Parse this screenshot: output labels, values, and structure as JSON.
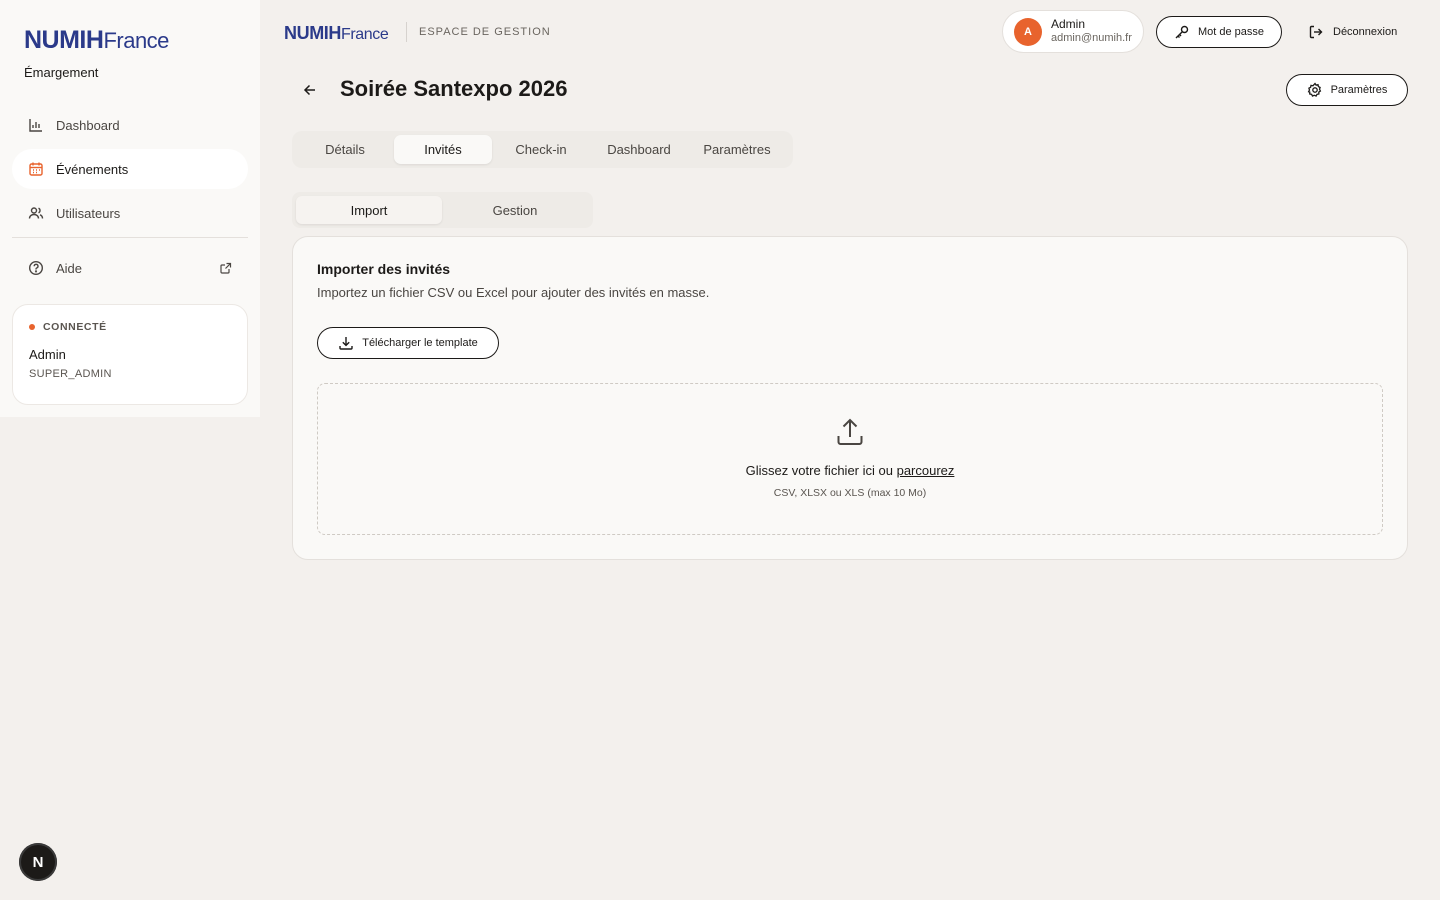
{
  "sidebar": {
    "logo_brand": "NUMIH",
    "logo_suffix": "France",
    "app_name": "Émargement",
    "items": [
      {
        "label": "Dashboard",
        "icon": "bar-chart-icon"
      },
      {
        "label": "Événements",
        "icon": "calendar-icon"
      },
      {
        "label": "Utilisateurs",
        "icon": "users-icon"
      }
    ],
    "help": {
      "label": "Aide",
      "icon": "help-circle-icon",
      "ext_icon": "external-link-icon"
    },
    "user_card": {
      "status": "CONNECTÉ",
      "name": "Admin",
      "role": "SUPER_ADMIN"
    },
    "bottom_badge": "N"
  },
  "header": {
    "logo_brand": "NUMIH",
    "logo_suffix": "France",
    "space_label": "ESPACE DE GESTION",
    "admin": {
      "initial": "A",
      "name": "Admin",
      "email": "admin@numih.fr"
    },
    "password_label": "Mot de passe",
    "logout_label": "Déconnexion"
  },
  "page": {
    "title": "Soirée Santexpo 2026",
    "settings_label": "Paramètres",
    "tabs": [
      "Détails",
      "Invités",
      "Check-in",
      "Dashboard",
      "Paramètres"
    ],
    "active_tab": "Invités",
    "subtabs": [
      "Import",
      "Gestion"
    ],
    "active_subtab": "Import"
  },
  "import_card": {
    "title": "Importer des invités",
    "description": "Importez un fichier CSV ou Excel pour ajouter des invités en masse.",
    "template_button": "Télécharger le template",
    "dropzone_text": "Glissez votre fichier ici ou",
    "dropzone_link": "parcourez",
    "dropzone_hint": "CSV, XLSX ou XLS (max 10 Mo)"
  },
  "colors": {
    "accent": "#e8632d",
    "brand": "#2b3a8a",
    "background": "#f3f0ed"
  }
}
